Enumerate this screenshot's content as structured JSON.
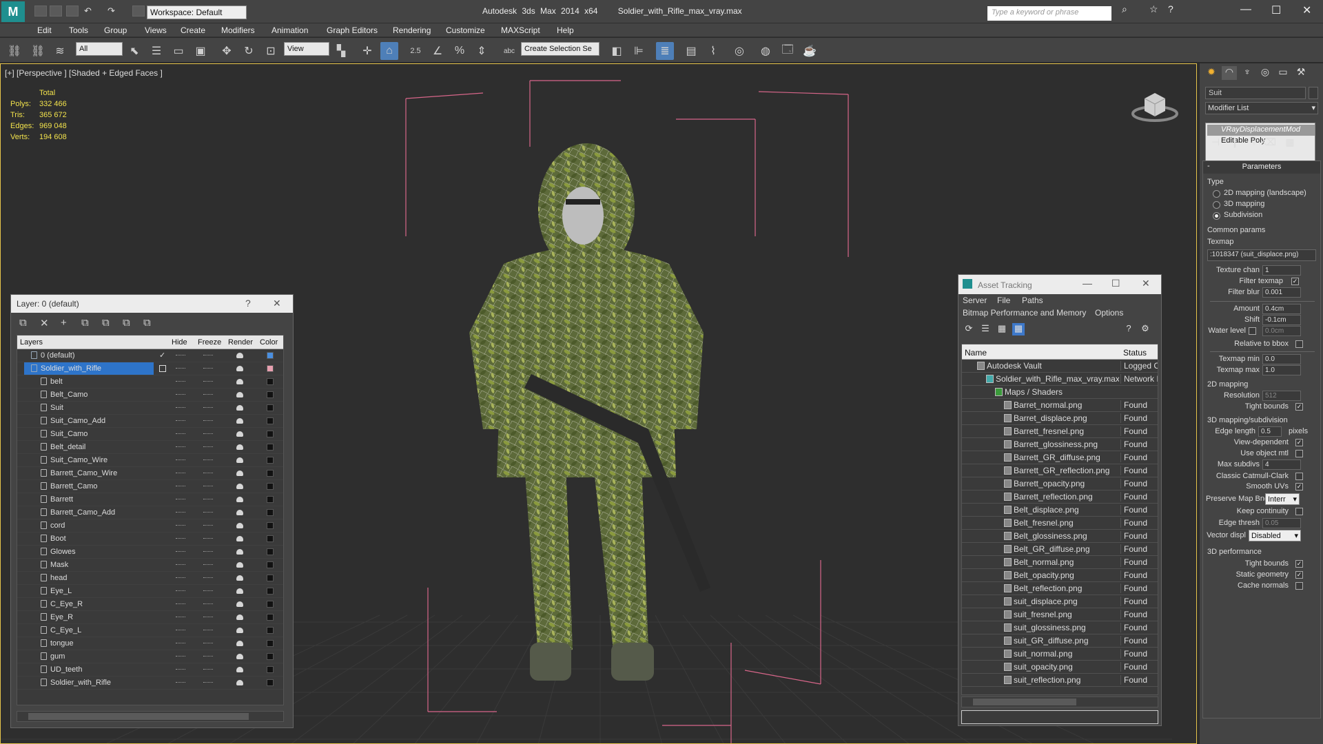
{
  "titlebar": {
    "workspace": "Workspace: Default",
    "app_title": "Autodesk 3ds Max  2014 x64",
    "file_title": "Soldier_with_Rifle_max_vray.max",
    "search_placeholder": "Type a keyword or phrase",
    "minimize": "—",
    "maximize": "☐",
    "close": "✕"
  },
  "menubar": [
    "Edit",
    "Tools",
    "Group",
    "Views",
    "Create",
    "Modifiers",
    "Animation",
    "Graph Editors",
    "Rendering",
    "Customize",
    "MAXScript",
    "Help"
  ],
  "toolbar": {
    "selection_filter": "All",
    "ref_coord": "View",
    "snap_angle": "2.5",
    "named_selection": "Create Selection Se"
  },
  "viewport": {
    "label": "[+] [Perspective ] [Shaded + Edged Faces ]",
    "stats": {
      "header": "Total",
      "rows": [
        {
          "label": "Polys:",
          "value": "332 466"
        },
        {
          "label": "Tris:",
          "value": "365 672"
        },
        {
          "label": "Edges:",
          "value": "969 048"
        },
        {
          "label": "Verts:",
          "value": "194 608"
        }
      ]
    }
  },
  "layer_panel": {
    "title": "Layer: 0 (default)",
    "help": "?",
    "close": "✕",
    "columns": {
      "layers": "Layers",
      "hide": "Hide",
      "freeze": "Freeze",
      "render": "Render",
      "color": "Color"
    },
    "rows": [
      {
        "name": "0 (default)",
        "type": "layer",
        "color": "#4a8fe0",
        "check": "✓"
      },
      {
        "name": "Soldier_with_Rifle",
        "type": "layer",
        "color": "#e8a0b0",
        "selected": true
      },
      {
        "name": "belt"
      },
      {
        "name": "Belt_Camo"
      },
      {
        "name": "Suit"
      },
      {
        "name": "Suit_Camo_Add"
      },
      {
        "name": "Suit_Camo"
      },
      {
        "name": "Belt_detail"
      },
      {
        "name": "Suit_Camo_Wire"
      },
      {
        "name": "Barrett_Camo_Wire"
      },
      {
        "name": "Barrett_Camo"
      },
      {
        "name": "Barrett"
      },
      {
        "name": "Barrett_Camo_Add"
      },
      {
        "name": "cord"
      },
      {
        "name": "Boot"
      },
      {
        "name": "Glowes"
      },
      {
        "name": "Mask"
      },
      {
        "name": "head"
      },
      {
        "name": "Eye_L"
      },
      {
        "name": "C_Eye_R"
      },
      {
        "name": "Eye_R"
      },
      {
        "name": "C_Eye_L"
      },
      {
        "name": "tongue"
      },
      {
        "name": "gum"
      },
      {
        "name": "UD_teeth"
      },
      {
        "name": "Soldier_with_Rifle"
      }
    ]
  },
  "asset_panel": {
    "title": "Asset Tracking",
    "menu1": [
      "Server",
      "File",
      "Paths"
    ],
    "menu2": [
      "Bitmap Performance and Memory",
      "Options"
    ],
    "columns": {
      "name": "Name",
      "status": "Status"
    },
    "rows": [
      {
        "name": "Autodesk Vault",
        "status": "Logged C",
        "indent": 0
      },
      {
        "name": "Soldier_with_Rifle_max_vray.max",
        "status": "Network I",
        "indent": 1
      },
      {
        "name": "Maps / Shaders",
        "status": "",
        "indent": 2
      },
      {
        "name": "Barret_normal.png",
        "status": "Found",
        "indent": 3
      },
      {
        "name": "Barret_displace.png",
        "status": "Found",
        "indent": 3
      },
      {
        "name": "Barrett_fresnel.png",
        "status": "Found",
        "indent": 3
      },
      {
        "name": "Barrett_glossiness.png",
        "status": "Found",
        "indent": 3
      },
      {
        "name": "Barrett_GR_diffuse.png",
        "status": "Found",
        "indent": 3
      },
      {
        "name": "Barrett_GR_reflection.png",
        "status": "Found",
        "indent": 3
      },
      {
        "name": "Barrett_opacity.png",
        "status": "Found",
        "indent": 3
      },
      {
        "name": "Barrett_reflection.png",
        "status": "Found",
        "indent": 3
      },
      {
        "name": "Belt_displace.png",
        "status": "Found",
        "indent": 3
      },
      {
        "name": "Belt_fresnel.png",
        "status": "Found",
        "indent": 3
      },
      {
        "name": "Belt_glossiness.png",
        "status": "Found",
        "indent": 3
      },
      {
        "name": "Belt_GR_diffuse.png",
        "status": "Found",
        "indent": 3
      },
      {
        "name": "Belt_normal.png",
        "status": "Found",
        "indent": 3
      },
      {
        "name": "Belt_opacity.png",
        "status": "Found",
        "indent": 3
      },
      {
        "name": "Belt_reflection.png",
        "status": "Found",
        "indent": 3
      },
      {
        "name": "suit_displace.png",
        "status": "Found",
        "indent": 3
      },
      {
        "name": "suit_fresnel.png",
        "status": "Found",
        "indent": 3
      },
      {
        "name": "suit_glossiness.png",
        "status": "Found",
        "indent": 3
      },
      {
        "name": "suit_GR_diffuse.png",
        "status": "Found",
        "indent": 3
      },
      {
        "name": "suit_normal.png",
        "status": "Found",
        "indent": 3
      },
      {
        "name": "suit_opacity.png",
        "status": "Found",
        "indent": 3
      },
      {
        "name": "suit_reflection.png",
        "status": "Found",
        "indent": 3
      }
    ]
  },
  "command_panel": {
    "object_name": "Suit",
    "modifier_list": "Modifier List",
    "stack": [
      "VRayDisplacementMod",
      "Editable Poly"
    ],
    "rollout_title": "Parameters",
    "type_group": "Type",
    "types": [
      "2D mapping (landscape)",
      "3D mapping",
      "Subdivision"
    ],
    "common_group": "Common params",
    "texmap_label": "Texmap",
    "texmap_value": ":1018347 (suit_displace.png)",
    "texture_chan_label": "Texture chan",
    "texture_chan": "1",
    "filter_texmap_label": "Filter texmap",
    "filter_blur_label": "Filter blur",
    "filter_blur": "0.001",
    "amount_label": "Amount",
    "amount": "0.4cm",
    "shift_label": "Shift",
    "shift": "-0.1cm",
    "water_level_label": "Water level",
    "water_level": "0.0cm",
    "relative_bbox_label": "Relative to bbox",
    "texmap_min_label": "Texmap min",
    "texmap_min": "0.0",
    "texmap_max_label": "Texmap max",
    "texmap_max": "1.0",
    "mapping2d_group": "2D mapping",
    "resolution_label": "Resolution",
    "resolution": "512",
    "tight_bounds_label": "Tight bounds",
    "subdiv_group": "3D mapping/subdivision",
    "edge_length_label": "Edge length",
    "edge_length": "0.5",
    "pixels_label": "pixels",
    "view_dependent_label": "View-dependent",
    "use_object_mtl_label": "Use object mtl",
    "max_subdivs_label": "Max subdivs",
    "max_subdivs": "4",
    "catmull_label": "Classic Catmull-Clark",
    "smooth_uvs_label": "Smooth UVs",
    "preserve_label": "Preserve Map Bnd",
    "preserve_value": "Interr",
    "keep_continuity_label": "Keep continuity",
    "edge_thresh_label": "Edge thresh",
    "edge_thresh": "0.05",
    "vector_disp_label": "Vector displ",
    "vector_disp": "Disabled",
    "perf_group": "3D performance",
    "perf_tight_label": "Tight bounds",
    "static_geo_label": "Static geometry",
    "cache_normals_label": "Cache normals",
    "check": "✓"
  }
}
